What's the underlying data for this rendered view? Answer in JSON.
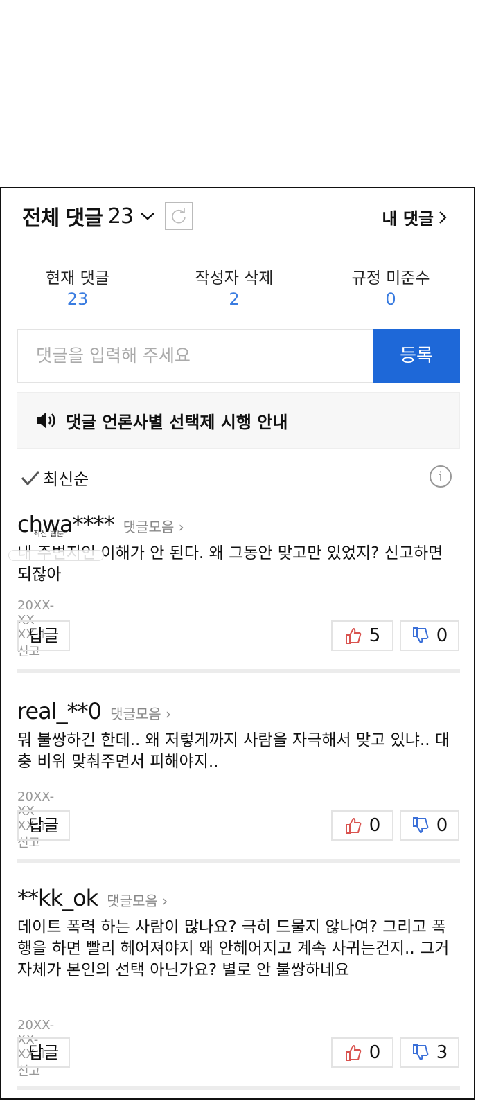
{
  "header": {
    "title": "전체 댓글",
    "count": "23",
    "my_comments": "내 댓글"
  },
  "stats": [
    {
      "label": "현재 댓글",
      "value": "23"
    },
    {
      "label": "작성자 삭제",
      "value": "2"
    },
    {
      "label": "규정 미준수",
      "value": "0"
    }
  ],
  "input": {
    "placeholder": "댓글을 입력해 주세요",
    "submit": "등록"
  },
  "notice": "댓글 언론사별 선택제 시행 안내",
  "sort": "최신순",
  "overlay_text": "최신 웹툰",
  "comments": [
    {
      "user": "chwa****",
      "collect": "댓글모음",
      "body": "내 주변지인 이해가 안 된다. 왜 그동안 맞고만 있었지? 신고하면 되잖아",
      "date": "20XX-XX-XX",
      "report": "신고",
      "reply": "답글",
      "likes": "5",
      "dislikes": "0"
    },
    {
      "user": "real_**0",
      "collect": "댓글모음",
      "body": "뭐 불쌍하긴 한데.. 왜 저렇게까지 사람을 자극해서 맞고 있냐.. 대충 비위 맞춰주면서 피해야지..",
      "date": "20XX-XX-XX",
      "report": "신고",
      "reply": "답글",
      "likes": "0",
      "dislikes": "0"
    },
    {
      "user": "**kk_ok",
      "collect": "댓글모음",
      "body": "데이트 폭력 하는 사람이 많나요? 극히 드물지 않나여? 그리고 폭행을 하면 빨리 헤어져야지 왜 안헤어지고 계속 사귀는건지.. 그거 자체가 본인의 선택 아닌가요? 별로 안 불쌍하네요",
      "date": "20XX-XX-XX",
      "report": "신고",
      "reply": "답글",
      "likes": "0",
      "dislikes": "3"
    }
  ],
  "colors": {
    "accent": "#1e68d8",
    "count_blue": "#3a7ce0",
    "like_red": "#d9534f",
    "dislike_blue": "#3a6fd8"
  }
}
